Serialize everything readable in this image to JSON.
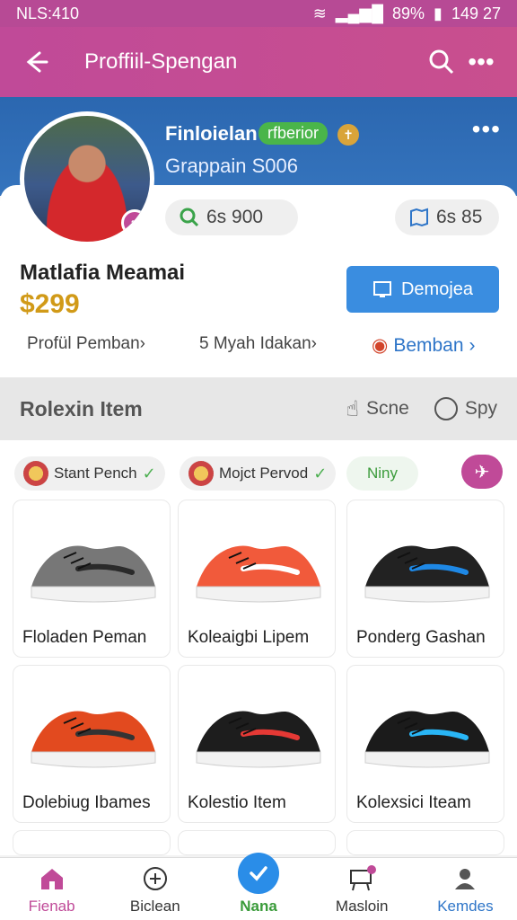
{
  "status_bar": {
    "left": "NLS:410",
    "battery": "89%",
    "time": "149 27"
  },
  "appbar": {
    "title": "Proffiil-Spengan"
  },
  "profile": {
    "name": "Finloielan",
    "tag": "rfberior",
    "subtitle": "Grappain S006",
    "stats": [
      {
        "icon": "search-icon",
        "value": "6s 900"
      },
      {
        "icon": "map-icon",
        "value": "6s 85"
      }
    ]
  },
  "product": {
    "title": "Matlafia Meamai",
    "price": "$299",
    "button": "Demojea",
    "links": [
      "Profül Pemban›",
      "5 Myah Idakan›",
      "Bemban"
    ]
  },
  "section": {
    "title": "Rolexin Item",
    "options": [
      "Scne",
      "Spy"
    ]
  },
  "filters": {
    "chips": [
      "Stant Pench",
      "Mojct Pervod",
      "Niny"
    ]
  },
  "items": [
    {
      "name": "Floladen Peman",
      "color": "#777777",
      "accent": "#2a2a2a"
    },
    {
      "name": "Koleaigbi Lipem",
      "color": "#f15a3b",
      "accent": "#ffffff"
    },
    {
      "name": "Ponderg Gashan",
      "color": "#222222",
      "accent": "#1e88e5"
    },
    {
      "name": "Dolebiug Ibames",
      "color": "#e24a1f",
      "accent": "#333333"
    },
    {
      "name": "Kolestio Item",
      "color": "#1d1d1d",
      "accent": "#e53935"
    },
    {
      "name": "Kolexsici Iteam",
      "color": "#1b1b1b",
      "accent": "#29b6f6"
    }
  ],
  "bottom_nav": [
    "Fienab",
    "Biclean",
    "Nana",
    "Masloin",
    "Kemdes"
  ]
}
